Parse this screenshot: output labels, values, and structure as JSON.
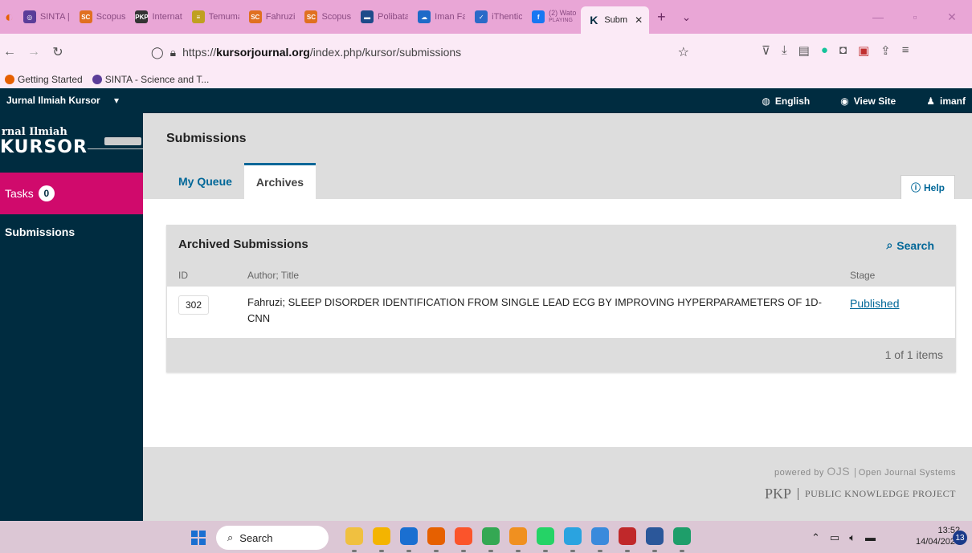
{
  "browser": {
    "tabs": [
      {
        "label": "SINTA |",
        "icon": "sinta-icon",
        "color": "#5b3d99",
        "glyph": "◎"
      },
      {
        "label": "Scopus",
        "icon": "scopus-icon",
        "color": "#e07020",
        "glyph": "SC"
      },
      {
        "label": "Internat",
        "icon": "pkp-icon",
        "color": "#333333",
        "glyph": "PKP"
      },
      {
        "label": "Temuma",
        "icon": "journal-icon",
        "color": "#c0a020",
        "glyph": "≡"
      },
      {
        "label": "Fahruzi",
        "icon": "scopus-icon",
        "color": "#e07020",
        "glyph": "SC"
      },
      {
        "label": "Scopus",
        "icon": "scopus-icon",
        "color": "#e07020",
        "glyph": "SC"
      },
      {
        "label": "Polibata",
        "icon": "polibatam-icon",
        "color": "#1e4a8a",
        "glyph": "▬"
      },
      {
        "label": "Iman Fa",
        "icon": "onedrive-icon",
        "color": "#1e6ac8",
        "glyph": "☁"
      },
      {
        "label": "iThentic",
        "icon": "check-icon",
        "color": "#2a6ac8",
        "glyph": "✓"
      },
      {
        "label": "(2) Wato",
        "sublabel": "PLAYING",
        "icon": "facebook-icon",
        "color": "#1877f2",
        "glyph": "f"
      }
    ],
    "active_tab": {
      "label": "Subm",
      "icon": "kursor-icon",
      "glyph": "K"
    },
    "new_tab": "+",
    "tab_list": "⌄",
    "url_prefix": "https://",
    "url_domain": "kursorjournal.org",
    "url_path": "/index.php/kursor/submissions",
    "bookmarks": [
      {
        "label": "Getting Started",
        "icon": "firefox-icon",
        "color": "#e66000"
      },
      {
        "label": "SINTA - Science and T...",
        "icon": "globe-icon",
        "color": "#5b3d99"
      }
    ]
  },
  "ojs": {
    "context_title": "Jurnal Ilmiah Kursor",
    "language": "English",
    "view_site": "View Site",
    "user": "imanf",
    "logo_line1": "rnal Ilmiah",
    "logo_line2": "KURSOR",
    "sidebar": {
      "tasks_label": "Tasks",
      "tasks_count": "0",
      "submissions_label": "Submissions"
    },
    "page_title": "Submissions",
    "tabs": [
      {
        "label": "My Queue",
        "active": false
      },
      {
        "label": "Archives",
        "active": true
      }
    ],
    "help_label": "Help",
    "panel": {
      "title": "Archived Submissions",
      "search_label": "Search",
      "col_id": "ID",
      "col_title": "Author; Title",
      "col_stage": "Stage",
      "rows": [
        {
          "id": "302",
          "title": "Fahruzi; SLEEP DISORDER IDENTIFICATION FROM SINGLE LEAD ECG BY IMPROVING HYPERPARAMETERS OF 1D-CNN",
          "stage": "Published"
        }
      ],
      "item_count": "1 of 1 items"
    },
    "footer": {
      "powered_by": "powered by",
      "ojs": "OJS",
      "ojs_full": "Open Journal Systems",
      "pkp": "PKP",
      "pkp_full": "PUBLIC KNOWLEDGE PROJECT"
    },
    "colors": {
      "header": "#002c40",
      "accent": "#d00a6c",
      "link": "#006798"
    }
  },
  "taskbar": {
    "search_placeholder": "Search",
    "time": "13:52",
    "date": "14/04/2023",
    "notifications": "13",
    "apps": [
      {
        "icon": "photos-icon",
        "color": "#f0c040"
      },
      {
        "icon": "explorer-icon",
        "color": "#f4b400"
      },
      {
        "icon": "mail-icon",
        "color": "#1a6fd1"
      },
      {
        "icon": "firefox-icon",
        "color": "#e66000"
      },
      {
        "icon": "brave-icon",
        "color": "#fb542b"
      },
      {
        "icon": "chrome-icon",
        "color": "#34a853"
      },
      {
        "icon": "app-icon",
        "color": "#f09020"
      },
      {
        "icon": "whatsapp-icon",
        "color": "#25d366"
      },
      {
        "icon": "telegram-icon",
        "color": "#2aa3e0"
      },
      {
        "icon": "snipping-icon",
        "color": "#3a8adc"
      },
      {
        "icon": "zotero-icon",
        "color": "#c0282a"
      },
      {
        "icon": "word-icon",
        "color": "#2b579a"
      },
      {
        "icon": "edge-icon",
        "color": "#1e9e6a"
      }
    ]
  }
}
